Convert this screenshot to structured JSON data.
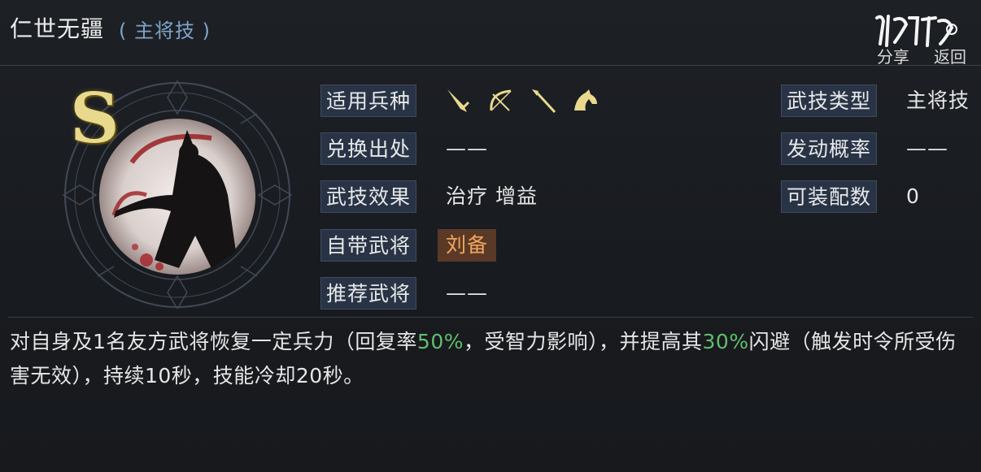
{
  "skill": {
    "name": "仁世无疆",
    "type_tag": "( 主将技 )",
    "grade": "S"
  },
  "header": {
    "logo_text": "游戏",
    "share_label": "分享",
    "back_label": "返回"
  },
  "fields": {
    "troops_label": "适用兵种",
    "troop_icons": [
      "sword-icon",
      "bow-icon",
      "spear-icon",
      "horse-icon"
    ],
    "source_label": "兑换出处",
    "source_value": "——",
    "effect_label": "武技效果",
    "effect_value": "治疗 增益",
    "hero_label": "自带武将",
    "hero_value": "刘备",
    "recommend_label": "推荐武将",
    "recommend_value": "——",
    "skill_type_label": "武技类型",
    "skill_type_value": "主将技",
    "trigger_label": "发动概率",
    "trigger_value": "——",
    "equip_label": "可装配数",
    "equip_value": "0"
  },
  "description": {
    "part1": "对自身及1名友方武将恢复一定兵力（回复率",
    "pct1": "50%",
    "part2": "，受智力影响），并提高其",
    "pct2": "30%",
    "part3": "闪避（触发时令所受伤害无效），持续10秒，技能冷却20秒。"
  },
  "colors": {
    "label_bg": "#283446",
    "highlight": "#5fbf6d",
    "hero_tag_bg": "#5a3a26",
    "hero_tag_text": "#f1a55e",
    "title_type": "#7ea3c9",
    "grade_gold": "#e9d98c"
  }
}
